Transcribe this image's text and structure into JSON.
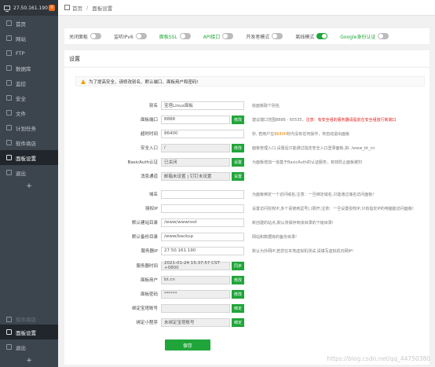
{
  "sidebar": {
    "ip": "27.50.161.190",
    "badge": "0",
    "items": [
      {
        "label": "首页",
        "icon": "home-icon"
      },
      {
        "label": "网站",
        "icon": "globe-icon"
      },
      {
        "label": "FTP",
        "icon": "ftp-icon"
      },
      {
        "label": "数据库",
        "icon": "database-icon"
      },
      {
        "label": "监控",
        "icon": "monitor-icon"
      },
      {
        "label": "安全",
        "icon": "shield-icon"
      },
      {
        "label": "文件",
        "icon": "folder-icon"
      },
      {
        "label": "计划任务",
        "icon": "clock-icon"
      },
      {
        "label": "软件商店",
        "icon": "store-icon"
      },
      {
        "label": "面板设置",
        "icon": "gear-icon",
        "active": true
      },
      {
        "label": "退出",
        "icon": "logout-icon"
      }
    ],
    "bottom_items": [
      {
        "label": "软件商店",
        "icon": "store-icon"
      },
      {
        "label": "面板设置",
        "icon": "gear-icon",
        "active": true
      },
      {
        "label": "退出",
        "icon": "logout-icon"
      }
    ]
  },
  "breadcrumb": {
    "home": "首页",
    "sep": "/",
    "current": "面板设置"
  },
  "toggles": [
    {
      "label": "关闭面板",
      "on": false
    },
    {
      "label": "监听IPv6",
      "on": false
    },
    {
      "label": "面板SSL",
      "on": false,
      "green": true
    },
    {
      "label": "API接口",
      "on": false,
      "green": true
    },
    {
      "label": "开发者模式",
      "on": false
    },
    {
      "label": "离线模式",
      "on": true
    },
    {
      "label": "Google身份认证",
      "on": false,
      "green": true
    }
  ],
  "panel": {
    "title": "设置",
    "warning": "为了提高安全，请修改别名、默认端口、面板用户和密码!",
    "save_label": "保存"
  },
  "fields": [
    {
      "label": "别名",
      "value": "宝塔Linux面板",
      "hint": "给面板取个别名"
    },
    {
      "label": "面板端口",
      "value": "8888",
      "btn": "修改",
      "hint_pre": "建议端口范围8888 - 65535，",
      "hint_red": "注意：有安全组的服务器请提前在安全组放行新端口"
    },
    {
      "label": "超时时间",
      "value": "86400",
      "hint_pre": "秒, 若用户在",
      "hint_orange": "86400",
      "hint_post": "秒内没有任何操作，将自动退出面板"
    },
    {
      "label": "安全入口",
      "value": "/",
      "btn": "修改",
      "gray": true,
      "hint": "面板管理入口,设置后只能通过指定安全入口登录面板,如: /www_bt_cn"
    },
    {
      "label": "BasicAuth认证",
      "value": "已关闭",
      "btn": "设置",
      "gray": true,
      "hint": "为面板增加一道基于BasicAuth的认证服务，有效防止面板被扫"
    },
    {
      "label": "消息通道",
      "value": "邮箱未设置 | 钉钉未设置",
      "btn": "设置",
      "gray": true,
      "hint": ""
    },
    {
      "label": "域名",
      "value": "",
      "hint": "为面板绑定一个访问域名;注意：一旦绑定域名,只能通过域名访问面板!"
    },
    {
      "label": "授权IP",
      "value": "",
      "hint": "设置访问授权IP,多个请使用逗号(,)隔开;注意：一旦设置授权IP,只有指定IP的电脑能访问面板!"
    },
    {
      "label": "默认建站目录",
      "value": "/www/wwwroot",
      "hint": "新创建的站点,默认将保存到该目录的下级目录!"
    },
    {
      "label": "默认备份目录",
      "value": "/www/backup",
      "hint": "网站和数据库的备份目录!"
    },
    {
      "label": "服务器IP",
      "value": "27.50.161.190",
      "hint": "默认为外网IP,若您在本地虚拟机测试,请填写虚拟机内网IP!"
    },
    {
      "label": "服务器时间",
      "value": "2021-01-24 15:37:57 CST +0800",
      "btn": "同步",
      "gray": true,
      "hint": ""
    },
    {
      "label": "面板用户",
      "value": "bt.cn",
      "btn": "修改",
      "gray": true,
      "hint": ""
    },
    {
      "label": "面板密码",
      "value": "******",
      "btn": "修改",
      "gray": true,
      "hint": ""
    },
    {
      "label": "绑定宝塔账号",
      "value": "",
      "btn": "绑定",
      "gray": true,
      "hint": ""
    },
    {
      "label": "绑定小程序",
      "value": "未绑定宝塔账号",
      "btn": "绑定",
      "gray": true,
      "hint": ""
    }
  ],
  "watermark": "https://blog.csdn.net/qq_44750380"
}
